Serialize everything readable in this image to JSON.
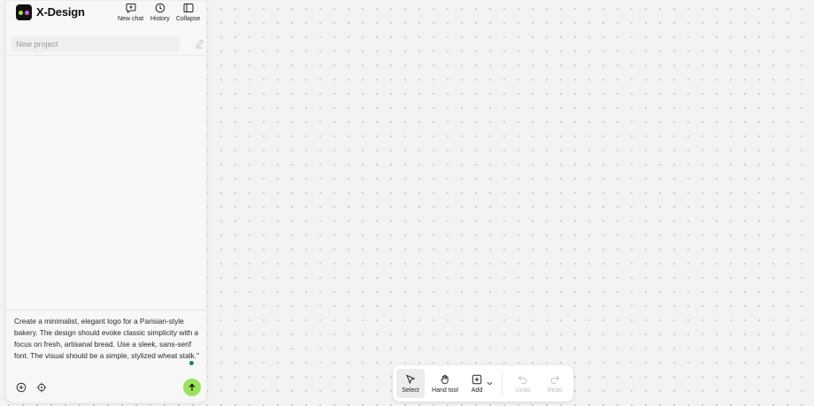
{
  "app": {
    "title": "X-Design"
  },
  "header": {
    "new_chat": "New chat",
    "history": "History",
    "collapse": "Collapse"
  },
  "project": {
    "placeholder": "New project"
  },
  "composer": {
    "prompt": "Create a minimalist, elegant logo for a Parisian-style bakery. The design should evoke classic simplicity with a focus on fresh, artisanal bread. Use a sleek, sans-serif font. The visual should be a simple, stylized wheat stalk.\""
  },
  "toolbar": {
    "select": "Select",
    "hand_tool": "Hand tool",
    "add": "Add",
    "undo": "Undo",
    "redo": "Redo"
  },
  "colors": {
    "accent_green": "#9be15d",
    "logo_pink": "#d45bd8",
    "status_dot": "#1e8a55"
  }
}
